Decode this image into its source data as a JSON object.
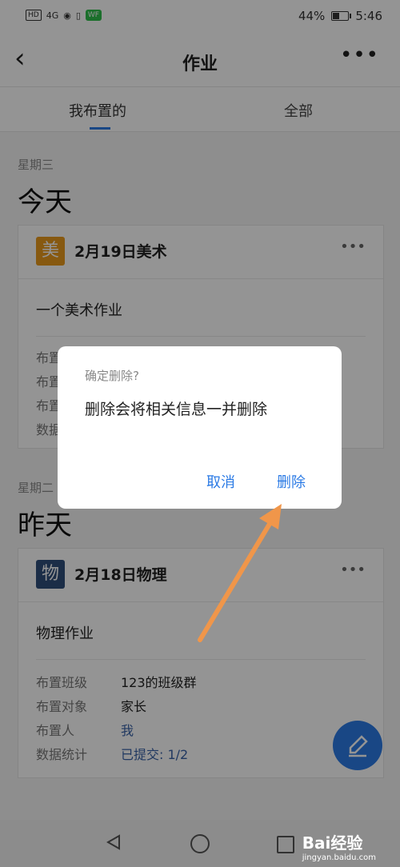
{
  "statusbar": {
    "left_icons": [
      "HD",
      "4G",
      "eye-icon",
      "vibrate-icon",
      "wifi-green"
    ],
    "battery": "44%",
    "time": "5:46"
  },
  "topbar": {
    "title": "作业",
    "back_icon": "back-arrow-icon",
    "more_icon": "more-icon"
  },
  "tabs": [
    {
      "label": "我布置的",
      "active": true
    },
    {
      "label": "全部",
      "active": false
    }
  ],
  "sections": [
    {
      "weekday": "星期三",
      "day": "今天",
      "card": {
        "icon_char": "美",
        "icon_color": "#e89a1c",
        "title": "2月19日美术",
        "desc": "一个美术作业",
        "rows": [
          {
            "label": "布置",
            "value": ""
          },
          {
            "label": "布置",
            "value": ""
          },
          {
            "label": "布置",
            "value": ""
          },
          {
            "label": "数据",
            "value": ""
          }
        ]
      }
    },
    {
      "weekday": "星期二",
      "day": "昨天",
      "card": {
        "icon_char": "物",
        "icon_color": "#2f4f7a",
        "title": "2月18日物理",
        "desc": "物理作业",
        "rows": [
          {
            "label": "布置班级",
            "value": "123的班级群"
          },
          {
            "label": "布置对象",
            "value": "家长"
          },
          {
            "label": "布置人",
            "value": "我"
          },
          {
            "label": "数据统计",
            "value": "已提交: 1/2"
          }
        ]
      }
    }
  ],
  "dialog": {
    "title": "确定删除?",
    "message": "删除会将相关信息一并删除",
    "cancel": "取消",
    "confirm": "删除"
  },
  "colors": {
    "accent": "#2c7be5",
    "arrow": "#f0964a"
  },
  "watermark": {
    "text": "Bai经验",
    "sub": "jingyan.baidu.com"
  }
}
